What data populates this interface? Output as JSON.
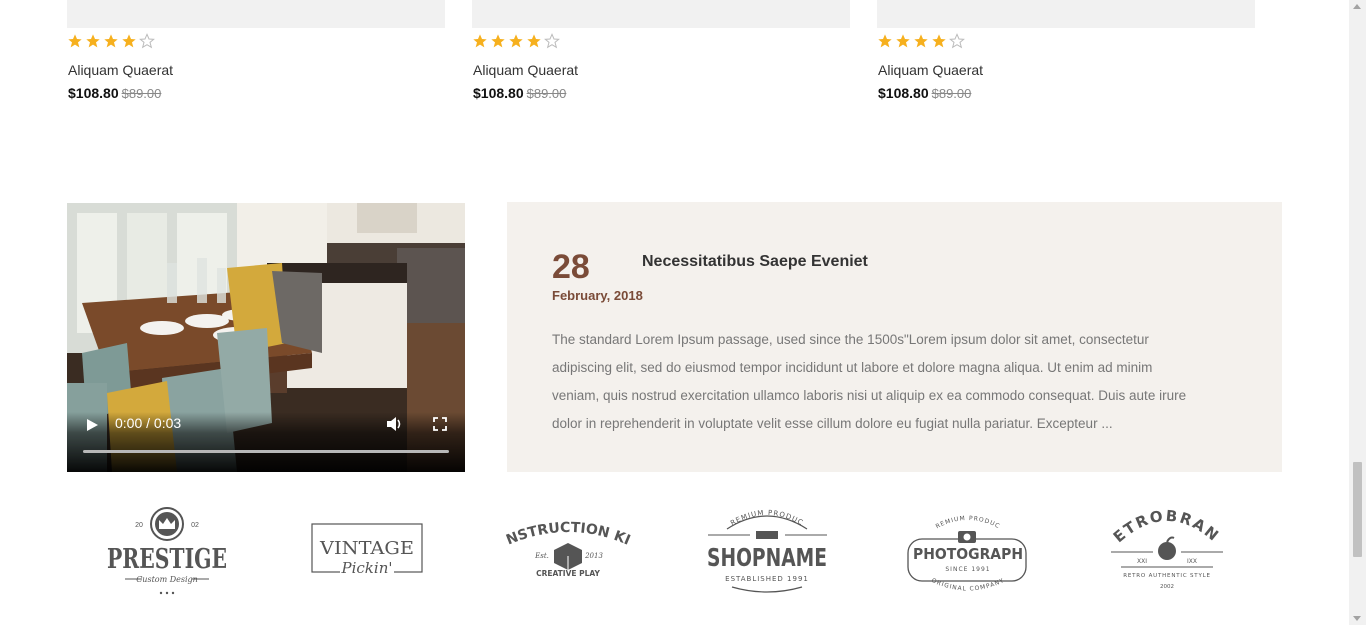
{
  "products": [
    {
      "name": "Aliquam Quaerat",
      "price": "$108.80",
      "old_price": "$89.00",
      "rating": 4,
      "max_rating": 5
    },
    {
      "name": "Aliquam Quaerat",
      "price": "$108.80",
      "old_price": "$89.00",
      "rating": 4,
      "max_rating": 5
    },
    {
      "name": "Aliquam Quaerat",
      "price": "$108.80",
      "old_price": "$89.00",
      "rating": 4,
      "max_rating": 5
    }
  ],
  "video": {
    "time": "0:00 / 0:03",
    "progress": 0
  },
  "blog": {
    "day": "28",
    "month_year": "February, 2018",
    "title": "Necessitatibus Saepe Eveniet",
    "excerpt": "The standard Lorem Ipsum passage, used since the 1500s\"Lorem ipsum dolor sit amet, consectetur adipiscing elit, sed do eiusmod tempor incididunt ut labore et dolore magna aliqua. Ut enim ad minim veniam, quis nostrud exercitation ullamco laboris nisi ut aliquip ex ea commodo consequat. Duis aute irure dolor in reprehenderit in voluptate velit esse cillum dolore eu fugiat nulla pariatur. Excepteur ..."
  },
  "brands": {
    "prestige": {
      "name": "PRESTIGE",
      "sub": "Custom Design",
      "left": "20",
      "right": "02"
    },
    "vintage": {
      "name": "VINTAGE",
      "sub": "Pickin'"
    },
    "construction": {
      "name": "CONSTRUCTION KIDS",
      "sub": "CREATIVE PLAY",
      "left": "Est.",
      "right": "2013"
    },
    "shopname": {
      "top": "PREMIUM PRODUCT",
      "name": "SHOPNAME",
      "sub": "ESTABLISHED 1991"
    },
    "photograph": {
      "top": "PREMIUM PRODUCT",
      "name": "PHOTOGRAPH",
      "mid": "SINCE 1991",
      "sub": "ORIGINAL COMPANY"
    },
    "retrobrand": {
      "name": "RETROBRAND",
      "left": "XXI",
      "right": "IXX",
      "sub": "RETRO AUTHENTIC STYLE",
      "year": "2002"
    }
  },
  "colors": {
    "star_filled": "#f6b01e",
    "star_empty": "#bbbbbb",
    "accent": "#7a4b38",
    "blog_bg": "#f4f1ed",
    "logo": "#555555"
  },
  "icons": [
    "star-icon",
    "play-icon",
    "volume-icon",
    "fullscreen-icon"
  ]
}
